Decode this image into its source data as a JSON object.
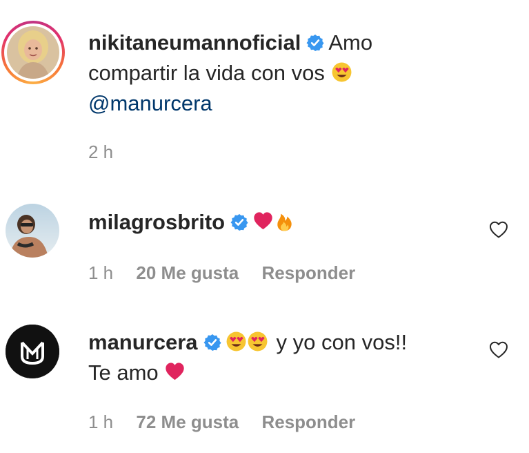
{
  "comments": [
    {
      "username": "nikitaneumannoficial",
      "text_part1": "Amo",
      "text_part2": "compartir la vida con vos",
      "mention": "@manurcera",
      "time": "2 h"
    },
    {
      "username": "milagrosbrito",
      "time": "1 h",
      "likes": "20 Me gusta",
      "reply": "Responder"
    },
    {
      "username": "manurcera",
      "text_part1": "y yo con vos!!",
      "text_part2": "Te amo",
      "time": "1 h",
      "likes": "72 Me gusta",
      "reply": "Responder"
    }
  ],
  "colors": {
    "text": "#262626",
    "meta": "#8e8e8e",
    "mention": "#00376b",
    "verified": "#3897f0",
    "heart": "#ed4956"
  }
}
